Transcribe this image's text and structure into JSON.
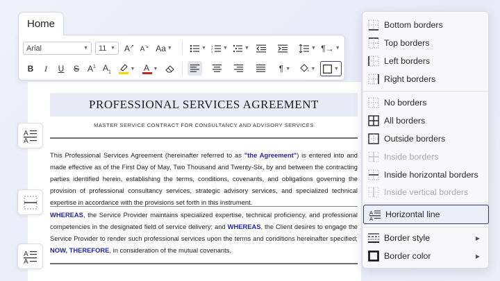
{
  "ribbon": {
    "tab_home": "Home",
    "font_name": "Arial",
    "font_size": "11"
  },
  "document": {
    "title": "PROFESSIONAL SERVICES AGREEMENT",
    "subtitle": "MASTER SERVICE CONTRACT FOR CONSULTANCY AND ADVISORY SERVICES",
    "p1_a": "This Professional Services Agreement (hereinafter referred to as ",
    "p1_quote": "\"the Agreement\"",
    "p1_b": ") is entered into and made effective as of the First Day of May, Two Thousand and Twenty-Six, by and between the contracting parties identified herein, establishing the terms, conditions, covenants, and obligations governing the provision of professional consultancy services, strategic advisory services, and specialized technical expertise in accordance with the provisions set forth in this instrument.",
    "p2_kw1": "WHEREAS",
    "p2_a": ", the Service Provider maintains specialized expertise, technical proficiency, and professional competencies in the designated field of service delivery; and ",
    "p2_kw2": "WHEREAS",
    "p2_b": ", the Client desires to engage the Service Provider to render such professional services upon the terms and conditions hereinafter specified; ",
    "p2_kw3": "NOW, THEREFORE",
    "p2_c": ", in consideration of the mutual covenants,"
  },
  "menu": {
    "items": [
      {
        "label": "Bottom borders",
        "icon": "border-bottom-icon",
        "enabled": true
      },
      {
        "label": "Top borders",
        "icon": "border-top-icon",
        "enabled": true
      },
      {
        "label": "Left borders",
        "icon": "border-left-icon",
        "enabled": true
      },
      {
        "label": "Right borders",
        "icon": "border-right-icon",
        "enabled": true
      },
      {
        "label": "No borders",
        "icon": "border-none-icon",
        "enabled": true
      },
      {
        "label": "All borders",
        "icon": "border-all-icon",
        "enabled": true
      },
      {
        "label": "Outside borders",
        "icon": "border-outside-icon",
        "enabled": true
      },
      {
        "label": "Inside borders",
        "icon": "border-inside-icon",
        "enabled": false
      },
      {
        "label": "Inside horizontal borders",
        "icon": "border-inside-horizontal-icon",
        "enabled": true
      },
      {
        "label": "Inside vertical borders",
        "icon": "border-inside-vertical-icon",
        "enabled": false
      },
      {
        "label": "Horizontal line",
        "icon": "horizontal-line-icon",
        "enabled": true,
        "highlighted": true
      },
      {
        "label": "Border style",
        "icon": "border-style-icon",
        "enabled": true,
        "submenu": true
      },
      {
        "label": "Border color",
        "icon": "border-color-icon",
        "enabled": true,
        "submenu": true
      }
    ]
  },
  "colors": {
    "accent": "#2e3384",
    "keyword": "#2323a8",
    "highlight_swatch": "#f5d400",
    "font_color_swatch": "#c62828"
  }
}
